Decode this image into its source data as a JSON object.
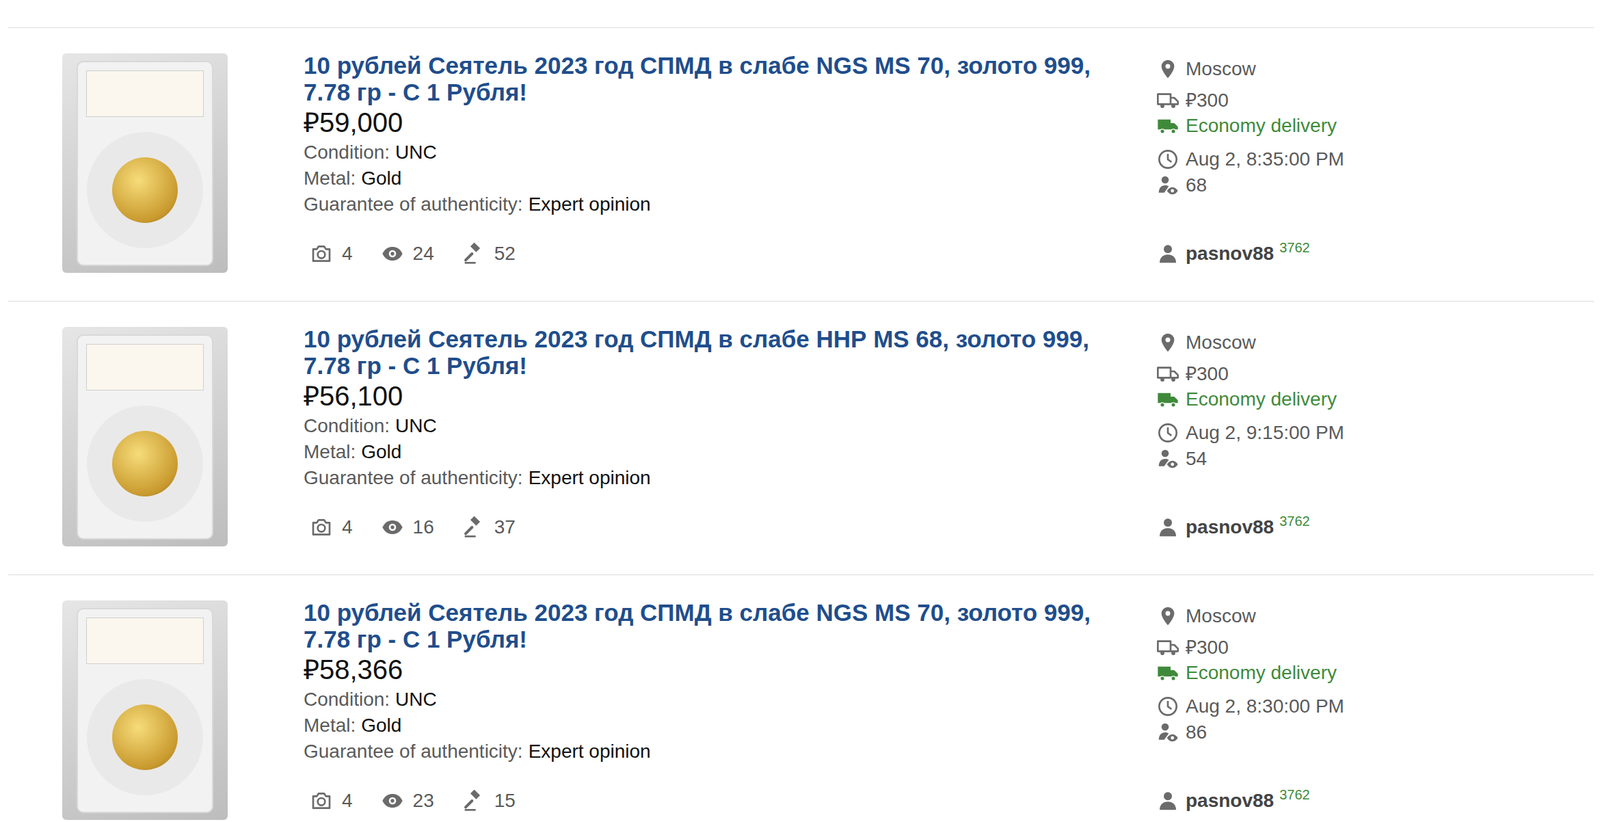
{
  "listings": [
    {
      "title": "10 рублей Сеятель 2023 год СПМД в слабе NGS MS 70, золото 999, 7.78 гр - С 1 Рубля!",
      "price": "₽59,000",
      "fields": [
        {
          "label": "Condition:",
          "value": "UNC"
        },
        {
          "label": "Metal:",
          "value": "Gold"
        },
        {
          "label": "Guarantee of authenticity:",
          "value": "Expert opinion"
        }
      ],
      "stats": [
        {
          "kind": "photos",
          "value": "4"
        },
        {
          "kind": "views",
          "value": "24"
        },
        {
          "kind": "bids",
          "value": "52"
        }
      ],
      "location": "Moscow",
      "shipping": "₽300",
      "delivery": "Economy delivery",
      "time": "Aug 2, 8:35:00 PM",
      "watchers": "68",
      "seller": "pasnov88",
      "rating": "3762"
    },
    {
      "title": "10 рублей Сеятель 2023 год СПМД в слабе ННР MS 68, золото 999, 7.78 гр - С 1 Рубля!",
      "price": "₽56,100",
      "fields": [
        {
          "label": "Condition:",
          "value": "UNC"
        },
        {
          "label": "Metal:",
          "value": "Gold"
        },
        {
          "label": "Guarantee of authenticity:",
          "value": "Expert opinion"
        }
      ],
      "stats": [
        {
          "kind": "photos",
          "value": "4"
        },
        {
          "kind": "views",
          "value": "16"
        },
        {
          "kind": "bids",
          "value": "37"
        }
      ],
      "location": "Moscow",
      "shipping": "₽300",
      "delivery": "Economy delivery",
      "time": "Aug 2, 9:15:00 PM",
      "watchers": "54",
      "seller": "pasnov88",
      "rating": "3762"
    },
    {
      "title": "10 рублей Сеятель 2023 год СПМД в слабе NGS MS 70, золото 999, 7.78 гр - С 1 Рубля!",
      "price": "₽58,366",
      "fields": [
        {
          "label": "Condition:",
          "value": "UNC"
        },
        {
          "label": "Metal:",
          "value": "Gold"
        },
        {
          "label": "Guarantee of authenticity:",
          "value": "Expert opinion"
        }
      ],
      "stats": [
        {
          "kind": "photos",
          "value": "4"
        },
        {
          "kind": "views",
          "value": "23"
        },
        {
          "kind": "bids",
          "value": "15"
        }
      ],
      "location": "Moscow",
      "shipping": "₽300",
      "delivery": "Economy delivery",
      "time": "Aug 2, 8:30:00 PM",
      "watchers": "86",
      "seller": "pasnov88",
      "rating": "3762"
    }
  ]
}
